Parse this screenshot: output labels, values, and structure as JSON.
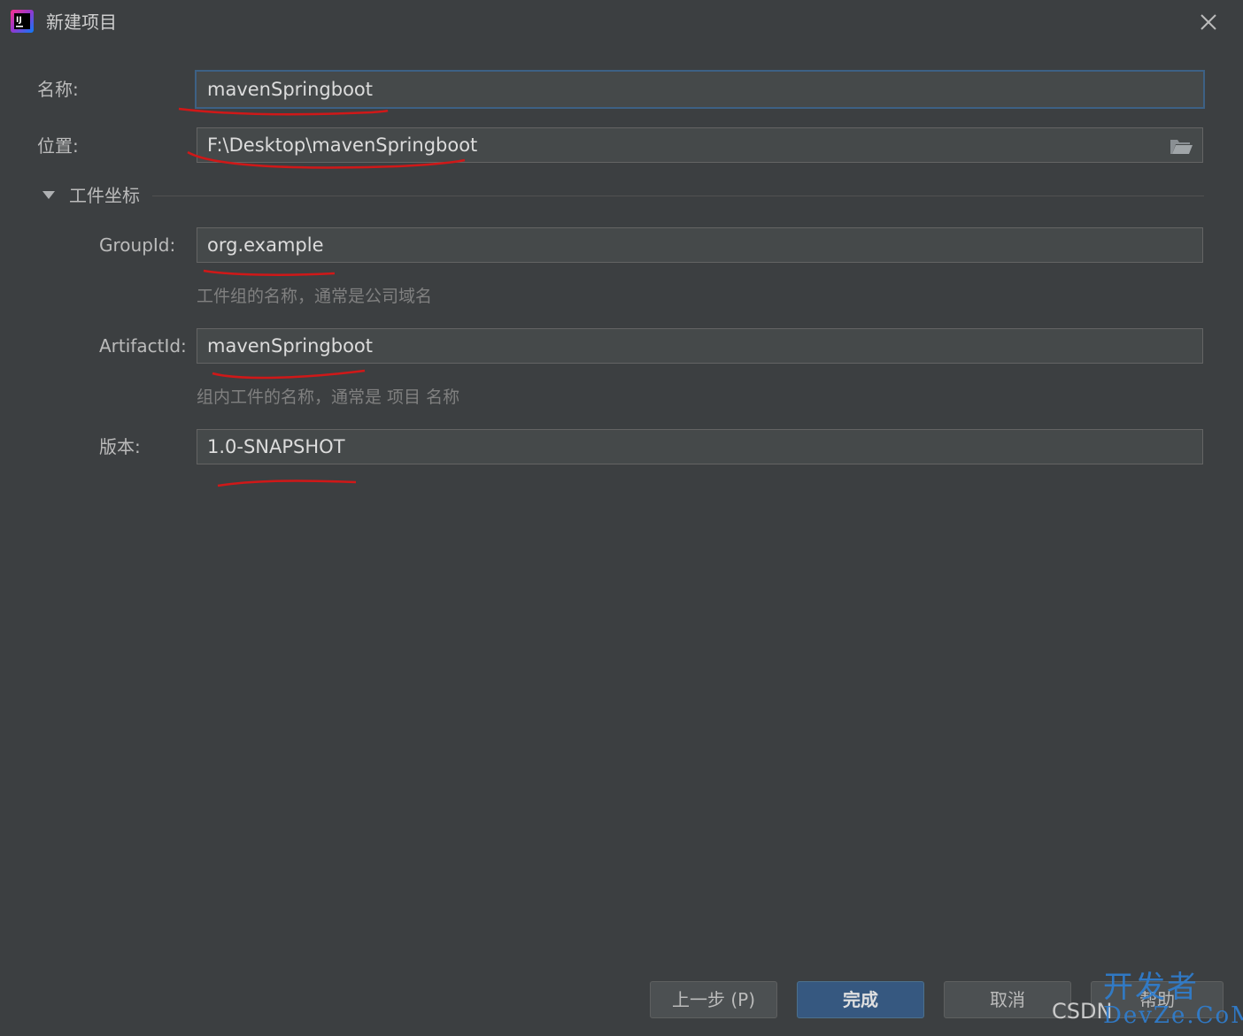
{
  "window": {
    "title": "新建项目",
    "app_icon": "intellij-idea-icon",
    "close_icon": "close-icon"
  },
  "form": {
    "name_label": "名称:",
    "name_value": "mavenSpringboot",
    "location_label": "位置:",
    "location_value": "F:\\Desktop\\mavenSpringboot",
    "location_browse_icon": "folder-open-icon",
    "section_title": "工件坐标",
    "group_id_label": "GroupId:",
    "group_id_value": "org.example",
    "group_id_hint": "工件组的名称，通常是公司域名",
    "artifact_id_label": "ArtifactId:",
    "artifact_id_value": "mavenSpringboot",
    "artifact_id_hint": "组内工件的名称，通常是 项目 名称",
    "version_label": "版本:",
    "version_value": "1.0-SNAPSHOT"
  },
  "buttons": {
    "previous": "上一步 (P)",
    "finish": "完成",
    "cancel": "取消",
    "help": "帮助"
  },
  "colors": {
    "background": "#3c3f41",
    "field_bg": "#45494a",
    "focus_border": "#3d6185",
    "primary_button": "#365880",
    "annotation_red": "#d01818"
  },
  "watermark": {
    "text": "CSDN",
    "overlay_text": "开发者",
    "overlay_sub": "DevZe.CoM"
  }
}
